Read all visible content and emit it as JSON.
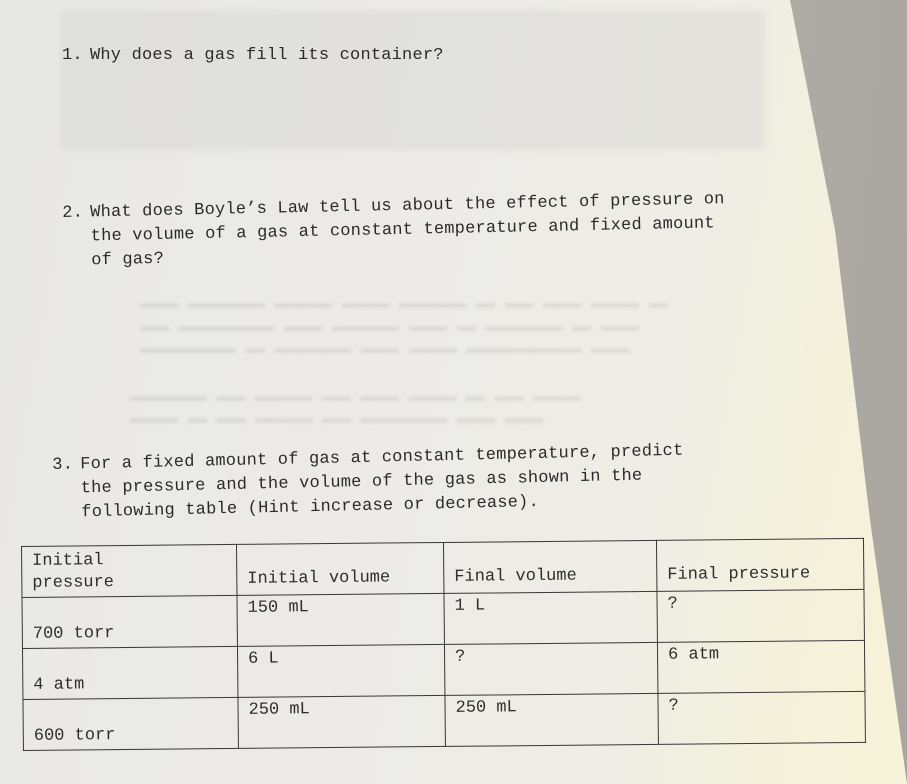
{
  "worksheet": {
    "questions": [
      {
        "number": "1.",
        "lines": [
          "Why does a gas fill its container?"
        ]
      },
      {
        "number": "2.",
        "lines": [
          "What does Boyle’s Law tell us about the effect of pressure on",
          "the volume of a gas at constant temperature and fixed amount",
          "of gas?"
        ]
      },
      {
        "number": "3.",
        "lines": [
          "For a fixed amount of gas at constant temperature, predict",
          "the pressure and the volume of the gas as shown in the",
          "following table (Hint increase or decrease)."
        ]
      }
    ],
    "table": {
      "headers": [
        "Initial pressure",
        "Initial volume",
        "Final volume",
        "Final pressure"
      ],
      "header_lines": [
        [
          "Initial",
          "pressure"
        ],
        [
          "Initial volume"
        ],
        [
          "Final volume"
        ],
        [
          "Final pressure"
        ]
      ],
      "rows": [
        [
          "700 torr",
          "150 mL",
          "1 L",
          "?"
        ],
        [
          "4 atm",
          "6 L",
          "?",
          "6 atm"
        ],
        [
          "600 torr",
          "250 mL",
          "250 mL",
          "?"
        ]
      ]
    }
  }
}
